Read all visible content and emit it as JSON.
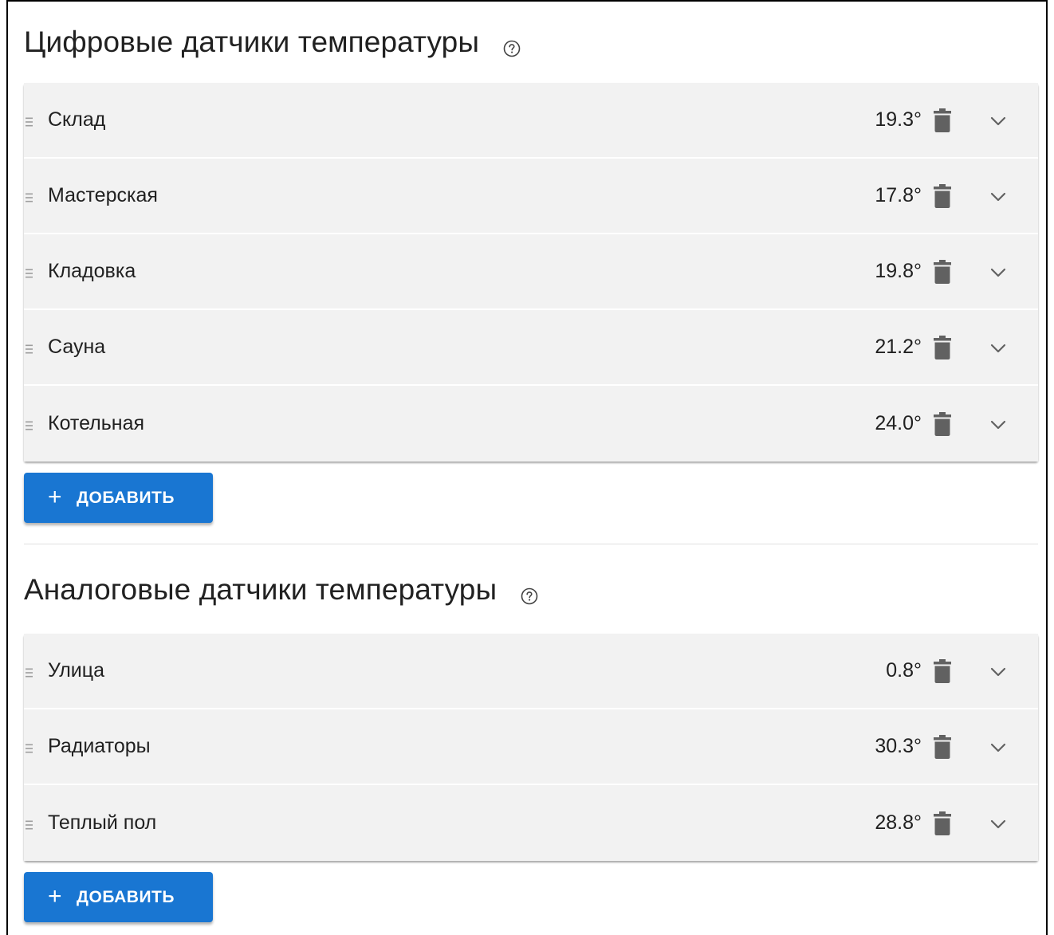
{
  "digital": {
    "title": "Цифровые датчики температуры",
    "sensors": [
      {
        "name": "Склад",
        "temp": "19.3°"
      },
      {
        "name": "Мастерская",
        "temp": "17.8°"
      },
      {
        "name": "Кладовка",
        "temp": "19.8°"
      },
      {
        "name": "Сауна",
        "temp": "21.2°"
      },
      {
        "name": "Котельная",
        "temp": "24.0°"
      }
    ],
    "add_label": "ДОБАВИТЬ"
  },
  "analog": {
    "title": "Аналоговые датчики температуры",
    "sensors": [
      {
        "name": "Улица",
        "temp": "0.8°"
      },
      {
        "name": "Радиаторы",
        "temp": "30.3°"
      },
      {
        "name": "Теплый пол",
        "temp": "28.8°"
      }
    ],
    "add_label": "ДОБАВИТЬ"
  },
  "icons": {
    "help": "help-circle-icon",
    "drag": "drag-handle-icon",
    "delete": "trash-icon",
    "expand": "chevron-down-icon",
    "add": "plus-icon"
  },
  "colors": {
    "primary": "#1976d2",
    "row_bg": "#f2f2f2",
    "icon": "#616161"
  }
}
